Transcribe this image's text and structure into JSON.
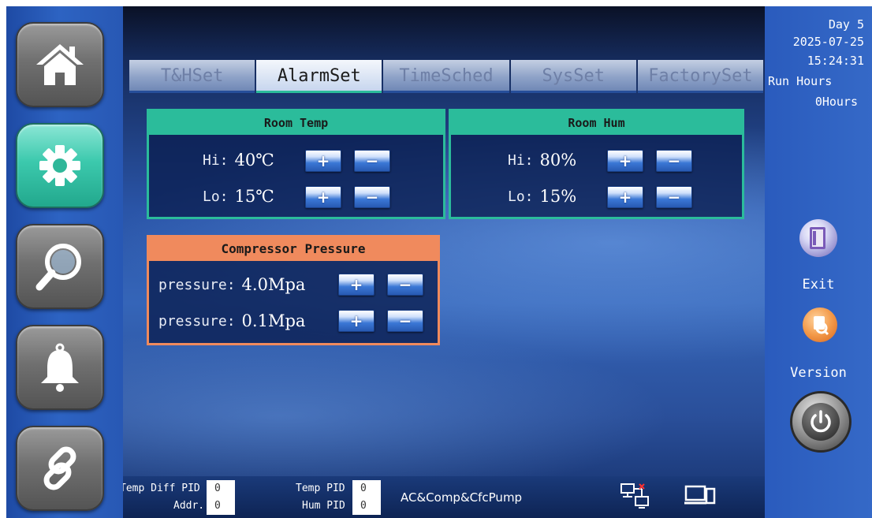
{
  "tabs": [
    {
      "label": "T&HSet"
    },
    {
      "label": "AlarmSet"
    },
    {
      "label": "TimeSched"
    },
    {
      "label": "SysSet"
    },
    {
      "label": "FactorySet"
    }
  ],
  "active_tab": "AlarmSet",
  "nav": {
    "items": [
      {
        "icon": "home-icon"
      },
      {
        "icon": "gear-icon"
      },
      {
        "icon": "search-icon"
      },
      {
        "icon": "bell-icon"
      },
      {
        "icon": "link-icon"
      }
    ],
    "active": "gear-icon"
  },
  "room_temp": {
    "title": "Room Temp",
    "hi_label": "Hi:",
    "hi_value": "40℃",
    "lo_label": "Lo:",
    "lo_value": "15℃"
  },
  "room_hum": {
    "title": "Room Hum",
    "hi_label": "Hi:",
    "hi_value": "80%",
    "lo_label": "Lo:",
    "lo_value": "15%"
  },
  "compressor": {
    "title": "Compressor Pressure",
    "hi_label": "pressure:",
    "hi_value": "4.0Mpa",
    "lo_label": "pressure:",
    "lo_value": "0.1Mpa"
  },
  "buttons": {
    "plus": "+",
    "minus": "−"
  },
  "status": {
    "temp_diff_pid_label": "Temp Diff PID",
    "temp_diff_pid_value": "0",
    "addr_label": "Addr.",
    "addr_value": "0",
    "temp_pid_label": "Temp PID",
    "temp_pid_value": "0",
    "hum_pid_label": "Hum PID",
    "hum_pid_value": "0",
    "mode": "AC&Comp&CfcPump"
  },
  "sidebar_right": {
    "day": "Day  5",
    "date": "2025-07-25",
    "time": "15:24:31",
    "run_hours_label": "Run Hours",
    "run_hours_value": "0Hours",
    "exit_label": "Exit",
    "version_label": "Version"
  },
  "colors": {
    "accent_green": "#2bbc9b",
    "accent_orange": "#f08a5d",
    "bg_blue": "#2a5bbd"
  }
}
